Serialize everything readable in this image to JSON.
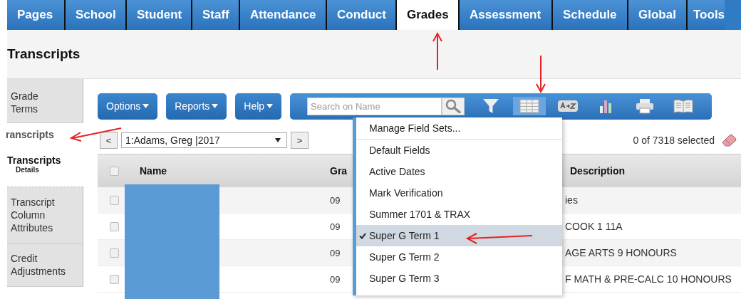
{
  "nav_tabs": [
    {
      "label": "Pages",
      "selected": false
    },
    {
      "label": "School",
      "selected": false
    },
    {
      "label": "Student",
      "selected": false
    },
    {
      "label": "Staff",
      "selected": false
    },
    {
      "label": "Attendance",
      "selected": false
    },
    {
      "label": "Conduct",
      "selected": false
    },
    {
      "label": "Grades",
      "selected": true
    },
    {
      "label": "Assessment",
      "selected": false
    },
    {
      "label": "Schedule",
      "selected": false
    },
    {
      "label": "Global",
      "selected": false
    },
    {
      "label": "Tools",
      "selected": false
    }
  ],
  "page_title": "Transcripts",
  "sidebar": [
    {
      "kind": "tab",
      "label": "Grade Terms"
    },
    {
      "kind": "current",
      "label": "ranscripts"
    },
    {
      "kind": "heading",
      "label": "Transcripts",
      "sublabel": "Details"
    },
    {
      "kind": "tab",
      "label": "Transcript Column Attributes"
    },
    {
      "kind": "tab",
      "label": "Credit Adjustments"
    }
  ],
  "menu_buttons": [
    {
      "label": "Options"
    },
    {
      "label": "Reports"
    },
    {
      "label": "Help"
    }
  ],
  "search": {
    "placeholder": "Search on Name"
  },
  "tool_icons": [
    {
      "kind": "filter",
      "selected": false
    },
    {
      "kind": "grid",
      "selected": true
    },
    {
      "kind": "sort",
      "selected": false
    },
    {
      "kind": "chart",
      "selected": false
    },
    {
      "kind": "print",
      "selected": false
    },
    {
      "kind": "book",
      "selected": false
    }
  ],
  "navigator": {
    "previous": "<",
    "record": "1:Adams, Greg |2017",
    "next": ">"
  },
  "selection_count": "0 of 7318 selected",
  "table": {
    "header_checked": false,
    "columns": [
      "Name",
      "Gra",
      "Description"
    ],
    "rows": [
      {
        "checked": false,
        "grade": "09",
        "description": "ies"
      },
      {
        "checked": false,
        "grade": "09",
        "description": "COOK 1 11A"
      },
      {
        "checked": false,
        "grade": "09",
        "description": "AGE ARTS 9 HONOURS"
      },
      {
        "checked": false,
        "grade": "09",
        "description": "F MATH & PRE-CALC 10 HONOURS"
      }
    ]
  },
  "field_set_menu": [
    {
      "kind": "action",
      "label": "Manage Field Sets...",
      "checked": false,
      "selected": false
    },
    {
      "kind": "set",
      "label": "Default Fields",
      "checked": false,
      "selected": false
    },
    {
      "kind": "set",
      "label": "Active Dates",
      "checked": false,
      "selected": false
    },
    {
      "kind": "set",
      "label": "Mark Verification",
      "checked": false,
      "selected": false
    },
    {
      "kind": "set",
      "label": "Summer 1701 & TRAX",
      "checked": false,
      "selected": false
    },
    {
      "kind": "set",
      "label": "Super G Term 1",
      "checked": true,
      "selected": true
    },
    {
      "kind": "set",
      "label": "Super G Term 2",
      "checked": false,
      "selected": false
    },
    {
      "kind": "set",
      "label": "Super G Term 3",
      "checked": false,
      "selected": false
    }
  ]
}
